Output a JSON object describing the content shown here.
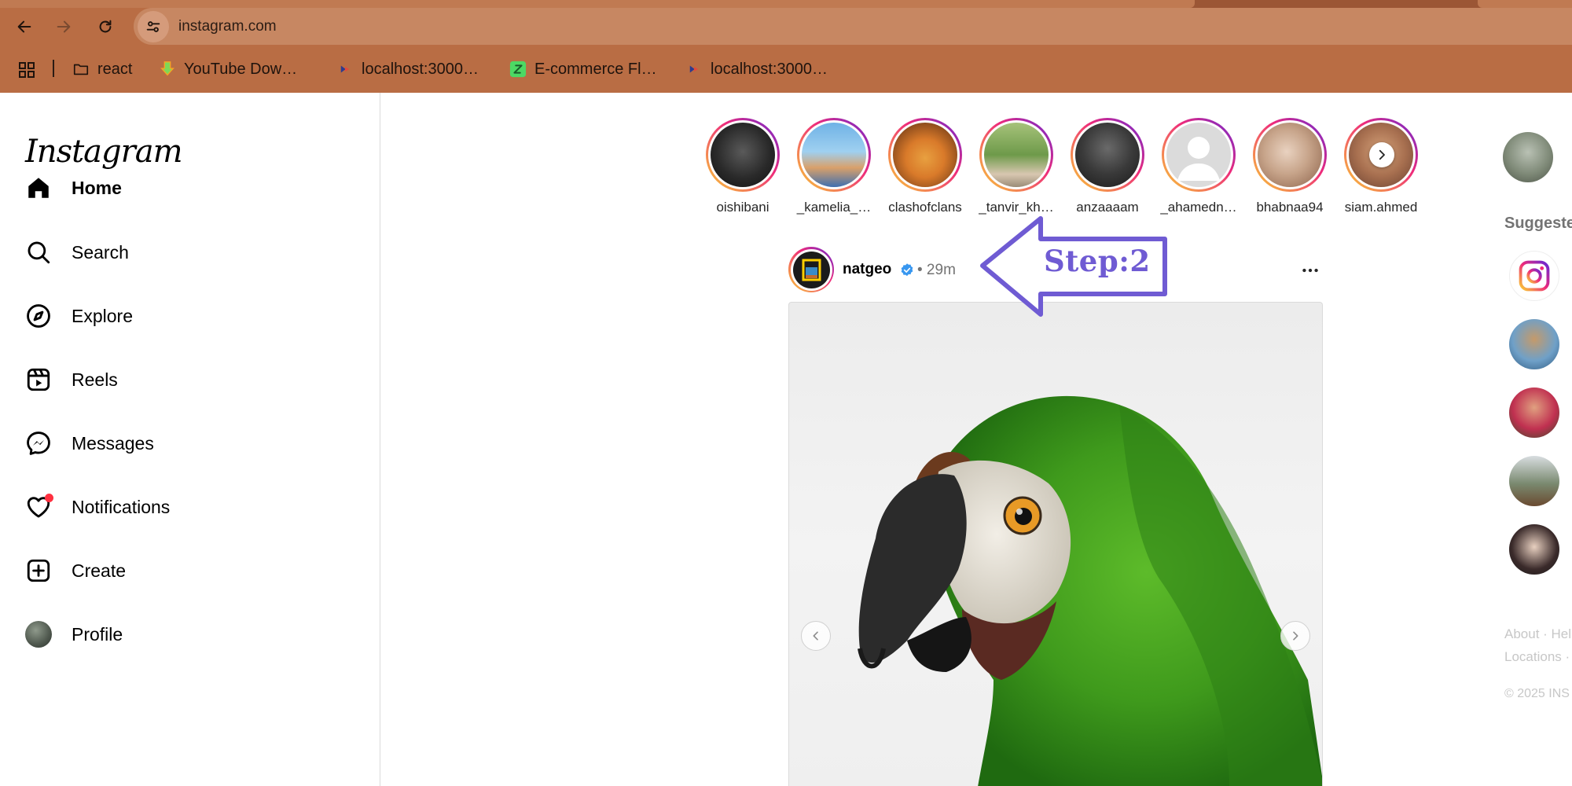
{
  "browser": {
    "url": "instagram.com",
    "theme_color": "#b96d44",
    "bookmarks": [
      {
        "label": "react",
        "icon": "folder-icon"
      },
      {
        "label": "YouTube Dow…",
        "icon": "download-icon"
      },
      {
        "label": "localhost:3000…",
        "icon": "react-icon"
      },
      {
        "label": "E-commerce Fl…",
        "icon": "ecommerce-icon"
      },
      {
        "label": "localhost:3000…",
        "icon": "react-icon"
      }
    ]
  },
  "sidebar": {
    "logo": "Instagram",
    "items": [
      {
        "label": "Home",
        "icon": "home-icon",
        "active": true
      },
      {
        "label": "Search",
        "icon": "search-icon"
      },
      {
        "label": "Explore",
        "icon": "explore-icon"
      },
      {
        "label": "Reels",
        "icon": "reels-icon"
      },
      {
        "label": "Messages",
        "icon": "messages-icon"
      },
      {
        "label": "Notifications",
        "icon": "heart-icon",
        "badge": true
      },
      {
        "label": "Create",
        "icon": "create-icon"
      },
      {
        "label": "Profile",
        "icon": "avatar"
      }
    ]
  },
  "stories": [
    {
      "name": "oishibani"
    },
    {
      "name": "_kamelia_…"
    },
    {
      "name": "clashofclans"
    },
    {
      "name": "_tanvir_kh…"
    },
    {
      "name": "anzaaaam"
    },
    {
      "name": "_ahamedn…"
    },
    {
      "name": "bhabnaa94"
    },
    {
      "name": "siam.ahmed"
    }
  ],
  "post": {
    "username": "natgeo",
    "verified": true,
    "time": "• 29m"
  },
  "annotation": {
    "label": "Step:2",
    "color": "#6f5bd3"
  },
  "right": {
    "me_extra": "̲",
    "suggested_title": "Suggeste",
    "footer_line1": "About · Hel",
    "footer_line2": "Locations ·",
    "copyright": "© 2025 INS"
  }
}
